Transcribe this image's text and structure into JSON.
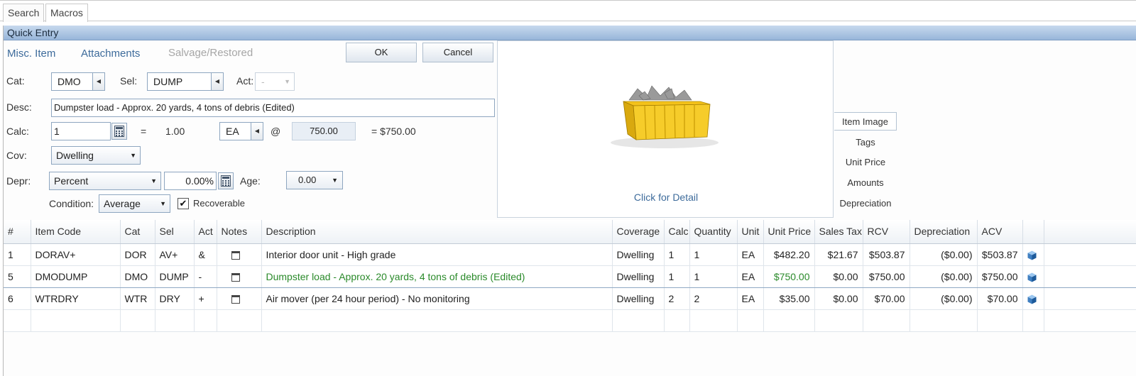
{
  "tabs": {
    "search": "Search",
    "macros": "Macros"
  },
  "panel_title": "Quick Entry",
  "links": {
    "misc_item": "Misc. Item",
    "attachments": "Attachments",
    "salvage": "Salvage/Restored"
  },
  "buttons": {
    "ok": "OK",
    "cancel": "Cancel"
  },
  "form": {
    "cat_label": "Cat:",
    "cat_value": "DMO",
    "sel_label": "Sel:",
    "sel_value": "DUMP",
    "act_label": "Act:",
    "act_value": "-",
    "desc_label": "Desc:",
    "desc_value": "Dumpster load - Approx. 20 yards, 4 tons of debris (Edited)",
    "calc_label": "Calc:",
    "calc_value": "1",
    "equals": "=",
    "calc_result": "1.00",
    "unit_value": "EA",
    "at": "@",
    "unit_price": "750.00",
    "total": "= $750.00",
    "cov_label": "Cov:",
    "cov_value": "Dwelling",
    "depr_label": "Depr:",
    "depr_type": "Percent",
    "depr_value": "0.00%",
    "age_label": "Age:",
    "age_value": "0.00",
    "condition_label": "Condition:",
    "condition_value": "Average",
    "recoverable_label": "Recoverable",
    "recoverable_checked": true
  },
  "image_panel": {
    "detail_link": "Click for Detail"
  },
  "side_tabs": [
    "Item Image",
    "Tags",
    "Unit Price",
    "Amounts",
    "Depreciation"
  ],
  "table": {
    "headers": [
      "#",
      "Item Code",
      "Cat",
      "Sel",
      "Act",
      "Notes",
      "Description",
      "Coverage",
      "Calc",
      "Quantity",
      "Unit",
      "Unit Price",
      "Sales Tax",
      "RCV",
      "Depreciation",
      "ACV"
    ],
    "rows": [
      {
        "num": "1",
        "code": "DORAV+",
        "cat": "DOR",
        "sel": "AV+",
        "act": "&",
        "desc": "Interior door unit - High grade",
        "coverage": "Dwelling",
        "calc": "1",
        "qty": "1",
        "unit": "EA",
        "price": "$482.20",
        "tax": "$21.67",
        "rcv": "$503.87",
        "depr": "($0.00)",
        "acv": "$503.87"
      },
      {
        "num": "5",
        "code": "DMODUMP",
        "cat": "DMO",
        "sel": "DUMP",
        "act": "-",
        "desc": "Dumpster load - Approx. 20 yards, 4 tons of debris (Edited)",
        "coverage": "Dwelling",
        "calc": "1",
        "qty": "1",
        "unit": "EA",
        "price": "$750.00",
        "tax": "$0.00",
        "rcv": "$750.00",
        "depr": "($0.00)",
        "acv": "$750.00"
      },
      {
        "num": "6",
        "code": "WTRDRY",
        "cat": "WTR",
        "sel": "DRY",
        "act": "+",
        "desc": "Air mover (per 24 hour period) - No monitoring",
        "coverage": "Dwelling",
        "calc": "2",
        "qty": "2",
        "unit": "EA",
        "price": "$35.00",
        "tax": "$0.00",
        "rcv": "$70.00",
        "depr": "($0.00)",
        "acv": "$70.00"
      }
    ]
  },
  "colors": {
    "title_bar": "#a9c3e2",
    "link": "#3d6b9b",
    "edited_text": "#2a8a2a"
  }
}
